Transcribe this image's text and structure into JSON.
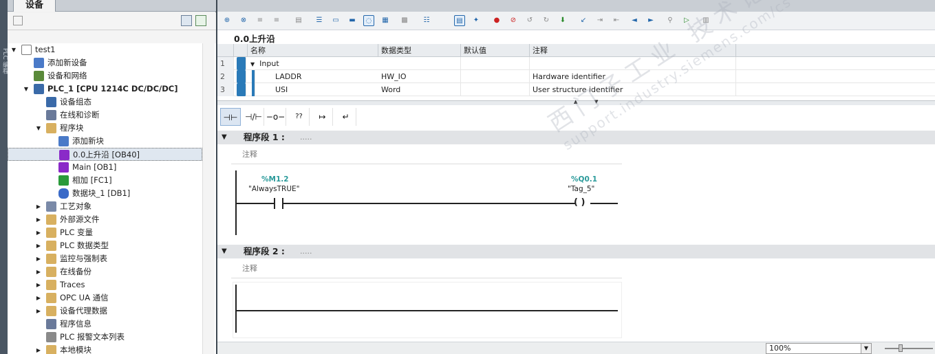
{
  "left_panel": {
    "tab_label": "设备",
    "tree": [
      {
        "label": "test1",
        "level": 0,
        "toggle": "▼",
        "icon": "project-icon",
        "selected": false,
        "bold": false
      },
      {
        "label": "添加新设备",
        "level": 1,
        "toggle": "",
        "icon": "add-device-icon",
        "selected": false,
        "bold": false
      },
      {
        "label": "设备和网络",
        "level": 1,
        "toggle": "",
        "icon": "network-icon",
        "selected": false,
        "bold": false
      },
      {
        "label": "PLC_1 [CPU 1214C DC/DC/DC]",
        "level": 1,
        "toggle": "▼",
        "icon": "plc-icon",
        "selected": false,
        "bold": true
      },
      {
        "label": "设备组态",
        "level": 2,
        "toggle": "",
        "icon": "device-config-icon",
        "selected": false,
        "bold": false
      },
      {
        "label": "在线和诊断",
        "level": 2,
        "toggle": "",
        "icon": "diagnostics-icon",
        "selected": false,
        "bold": false
      },
      {
        "label": "程序块",
        "level": 2,
        "toggle": "▼",
        "icon": "folder-icon",
        "selected": false,
        "bold": false
      },
      {
        "label": "添加新块",
        "level": 3,
        "toggle": "",
        "icon": "add-block-icon",
        "selected": false,
        "bold": false
      },
      {
        "label": "0.0上升沿 [OB40]",
        "level": 3,
        "toggle": "",
        "icon": "ob-block-icon",
        "selected": true,
        "bold": false
      },
      {
        "label": "Main [OB1]",
        "level": 3,
        "toggle": "",
        "icon": "ob-block-icon",
        "selected": false,
        "bold": false
      },
      {
        "label": "相加 [FC1]",
        "level": 3,
        "toggle": "",
        "icon": "fc-block-icon",
        "selected": false,
        "bold": false
      },
      {
        "label": "数据块_1 [DB1]",
        "level": 3,
        "toggle": "",
        "icon": "db-block-icon",
        "selected": false,
        "bold": false
      },
      {
        "label": "工艺对象",
        "level": 2,
        "toggle": "▶",
        "icon": "technology-icon",
        "selected": false,
        "bold": false
      },
      {
        "label": "外部源文件",
        "level": 2,
        "toggle": "▶",
        "icon": "source-file-icon",
        "selected": false,
        "bold": false
      },
      {
        "label": "PLC 变量",
        "level": 2,
        "toggle": "▶",
        "icon": "tag-table-icon",
        "selected": false,
        "bold": false
      },
      {
        "label": "PLC 数据类型",
        "level": 2,
        "toggle": "▶",
        "icon": "data-type-icon",
        "selected": false,
        "bold": false
      },
      {
        "label": "监控与强制表",
        "level": 2,
        "toggle": "▶",
        "icon": "watch-table-icon",
        "selected": false,
        "bold": false
      },
      {
        "label": "在线备份",
        "level": 2,
        "toggle": "▶",
        "icon": "backup-icon",
        "selected": false,
        "bold": false
      },
      {
        "label": "Traces",
        "level": 2,
        "toggle": "▶",
        "icon": "trace-icon",
        "selected": false,
        "bold": false
      },
      {
        "label": "OPC UA 通信",
        "level": 2,
        "toggle": "▶",
        "icon": "opc-ua-icon",
        "selected": false,
        "bold": false
      },
      {
        "label": "设备代理数据",
        "level": 2,
        "toggle": "▶",
        "icon": "proxy-data-icon",
        "selected": false,
        "bold": false
      },
      {
        "label": "程序信息",
        "level": 2,
        "toggle": "",
        "icon": "program-info-icon",
        "selected": false,
        "bold": false
      },
      {
        "label": "PLC 报警文本列表",
        "level": 2,
        "toggle": "",
        "icon": "alarm-text-icon",
        "selected": false,
        "bold": false
      },
      {
        "label": "本地模块",
        "level": 2,
        "toggle": "▶",
        "icon": "local-modules-icon",
        "selected": false,
        "bold": false
      }
    ]
  },
  "editor": {
    "block_title": "0.0上升沿",
    "interface": {
      "headers": {
        "name": "名称",
        "type": "数据类型",
        "default": "默认值",
        "comment": "注释"
      },
      "rows": [
        {
          "num": "1",
          "name": "Input",
          "type": "",
          "default": "",
          "comment": ""
        },
        {
          "num": "2",
          "name": "LADDR",
          "type": "HW_IO",
          "default": "",
          "comment": "Hardware identifier"
        },
        {
          "num": "3",
          "name": "USI",
          "type": "Word",
          "default": "",
          "comment": "User structure identifier"
        }
      ]
    },
    "ladder_tools": [
      "⊣⊢",
      "⊣/⊢",
      "−o−",
      "??",
      "↦",
      "↵"
    ],
    "networks": [
      {
        "title": "程序段 1 :",
        "dots": ".....",
        "comment": "注释"
      },
      {
        "title": "程序段 2 :",
        "dots": ".....",
        "comment": "注释"
      }
    ],
    "contact": {
      "address": "%M1.2",
      "tag": "\"AlwaysTRUE\""
    },
    "coil": {
      "address": "%Q0.1",
      "tag": "\"Tag_5\"",
      "symbol": "( )"
    },
    "zoom": "100%"
  },
  "watermark": {
    "line1": "西门子工业 技术论坛",
    "line2": "support.industry.siemens.com/cs"
  }
}
